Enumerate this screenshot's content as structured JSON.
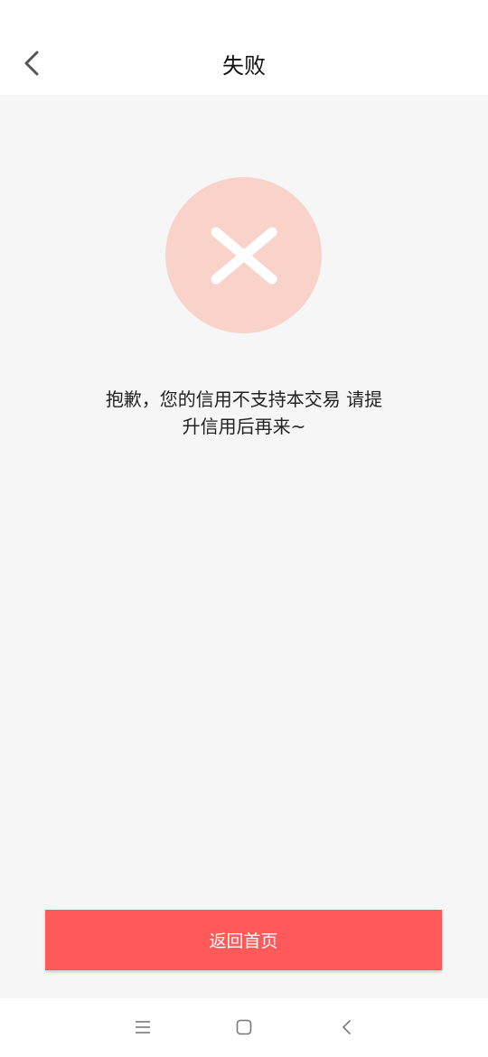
{
  "header": {
    "title": "失败",
    "back_icon": "chevron-left-icon"
  },
  "status": {
    "icon": "close-icon",
    "circle_color": "#f9d3c9",
    "cross_color": "#ffffff"
  },
  "message": {
    "line1": "抱歉，您的信用不支持本交易 请提",
    "line2": "升信用后再来~"
  },
  "actions": {
    "home_label": "返回首页",
    "home_color": "#ff5959"
  },
  "navigation": {
    "menu_icon": "menu-icon",
    "home_icon": "square-icon",
    "back_icon": "back-icon"
  }
}
